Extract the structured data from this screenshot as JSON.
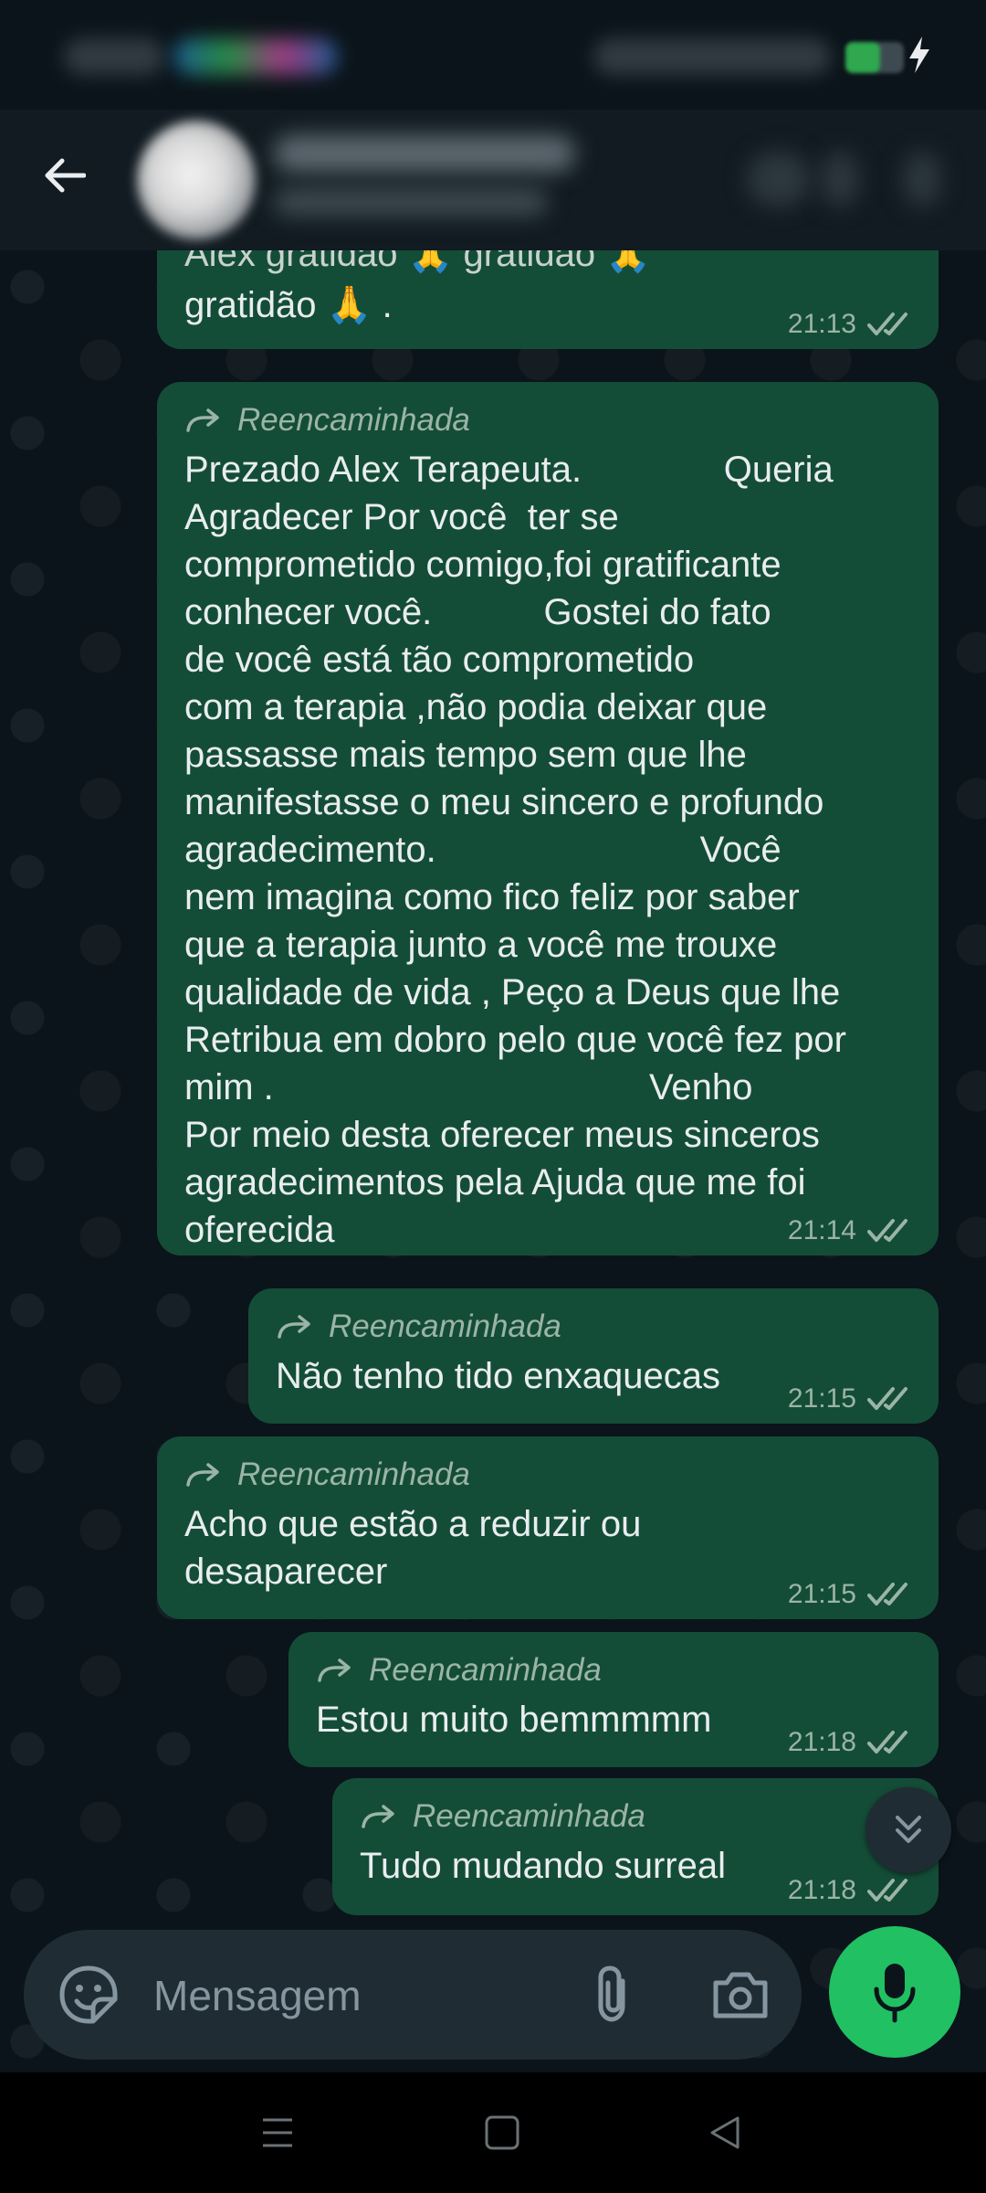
{
  "status_bar": {
    "battery_icon": "battery-icon",
    "charging_icon": "bolt-icon"
  },
  "header": {
    "back_icon": "arrow-back-icon"
  },
  "messages": [
    {
      "partial_top": "Alex gratidão 🙏 gratidão 🙏",
      "text": "gratidão 🙏 .",
      "time": "21:13",
      "status_icon": "double-check-icon"
    },
    {
      "forwarded_label": "Reencaminhada",
      "text": "Prezado Alex Terapeuta.              Queria\nAgradecer Por você  ter se\ncomprometido comigo,foi gratificante\nconhecer você.           Gostei do fato\nde você está tão comprometido\ncom a terapia ,não podia deixar que\npassasse mais tempo sem que lhe\nmanifestasse o meu sincero e profundo\nagradecimento.                          Você\nnem imagina como fico feliz por saber\nque a terapia junto a você me trouxe\nqualidade de vida , Peço a Deus que lhe\nRetribua em dobro pelo que você fez por\nmim .                                     Venho\nPor meio desta oferecer meus sinceros\nagradecimentos pela Ajuda que me foi\noferecida",
      "time": "21:14"
    },
    {
      "forwarded_label": "Reencaminhada",
      "text": "Não tenho tido enxaquecas",
      "time": "21:15"
    },
    {
      "forwarded_label": "Reencaminhada",
      "text": "Acho que estão a reduzir ou\ndesaparecer",
      "time": "21:15"
    },
    {
      "forwarded_label": "Reencaminhada",
      "text": "Estou muito bemmmmm",
      "time": "21:18"
    },
    {
      "forwarded_label": "Reencaminhada",
      "text": "Tudo mudando surreal",
      "time": "21:18"
    }
  ],
  "composer": {
    "placeholder": "Mensagem",
    "emoji_icon": "sticker-icon",
    "attach_icon": "paperclip-icon",
    "camera_icon": "camera-icon",
    "mic_icon": "microphone-icon"
  },
  "colors": {
    "background": "#0b141a",
    "bubble_outgoing": "#144d37",
    "accent_green": "#21c063",
    "meta_text": "#9bb4a8"
  }
}
